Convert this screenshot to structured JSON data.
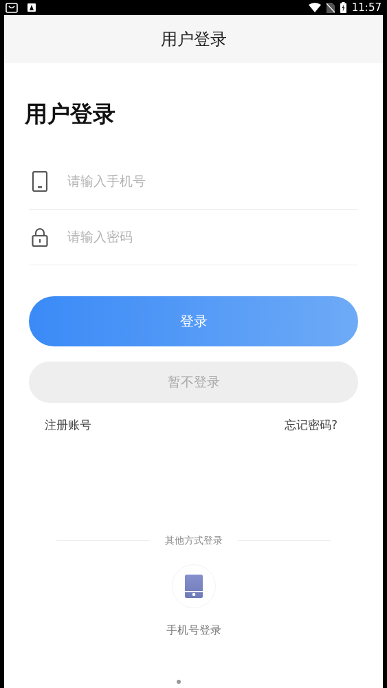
{
  "status_bar": {
    "time": "11:57"
  },
  "header": {
    "title": "用户登录"
  },
  "heading": "用户登录",
  "fields": [
    {
      "kind": "phone",
      "placeholder": "请输入手机号"
    },
    {
      "kind": "password",
      "placeholder": "请输入密码"
    }
  ],
  "login_button": "登录",
  "skip_button": "暂不登录",
  "links": [
    "注册账号",
    "忘记密码?"
  ],
  "other_methods": {
    "title": "其他方式登录",
    "items": [
      {
        "kind": "phone",
        "label": "手机号登录"
      }
    ]
  }
}
